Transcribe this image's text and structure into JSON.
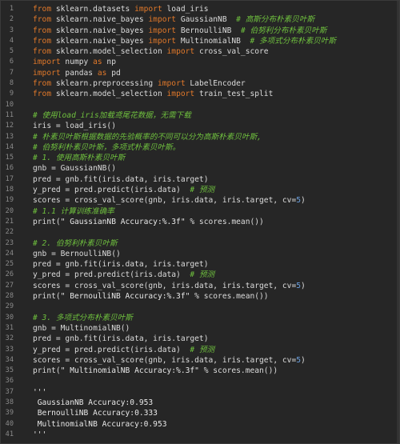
{
  "lines": [
    {
      "n": "1",
      "segs": [
        [
          "kw",
          "from"
        ],
        [
          "txt",
          " sklearn.datasets "
        ],
        [
          "kw",
          "import"
        ],
        [
          "txt",
          " load_iris"
        ]
      ]
    },
    {
      "n": "2",
      "segs": [
        [
          "kw",
          "from"
        ],
        [
          "txt",
          " sklearn.naive_bayes "
        ],
        [
          "kw",
          "import"
        ],
        [
          "txt",
          " GaussianNB  "
        ],
        [
          "cm",
          "# 高斯分布朴素贝叶斯"
        ]
      ]
    },
    {
      "n": "3",
      "segs": [
        [
          "kw",
          "from"
        ],
        [
          "txt",
          " sklearn.naive_bayes "
        ],
        [
          "kw",
          "import"
        ],
        [
          "txt",
          " BernoulliNB  "
        ],
        [
          "cm",
          "# 伯努利分布朴素贝叶斯"
        ]
      ]
    },
    {
      "n": "4",
      "segs": [
        [
          "kw",
          "from"
        ],
        [
          "txt",
          " sklearn.naive_bayes "
        ],
        [
          "kw",
          "import"
        ],
        [
          "txt",
          " MultinomialNB  "
        ],
        [
          "cm",
          "# 多项式分布朴素贝叶斯"
        ]
      ]
    },
    {
      "n": "5",
      "segs": [
        [
          "kw",
          "from"
        ],
        [
          "txt",
          " sklearn.model_selection "
        ],
        [
          "kw",
          "import"
        ],
        [
          "txt",
          " cross_val_score"
        ]
      ]
    },
    {
      "n": "6",
      "segs": [
        [
          "kw",
          "import"
        ],
        [
          "txt",
          " numpy "
        ],
        [
          "kw",
          "as"
        ],
        [
          "txt",
          " np"
        ]
      ]
    },
    {
      "n": "7",
      "segs": [
        [
          "kw",
          "import"
        ],
        [
          "txt",
          " pandas "
        ],
        [
          "kw",
          "as"
        ],
        [
          "txt",
          " pd"
        ]
      ]
    },
    {
      "n": "8",
      "segs": [
        [
          "kw",
          "from"
        ],
        [
          "txt",
          " sklearn.preprocessing "
        ],
        [
          "kw",
          "import"
        ],
        [
          "txt",
          " LabelEncoder"
        ]
      ]
    },
    {
      "n": "9",
      "segs": [
        [
          "kw",
          "from"
        ],
        [
          "txt",
          " sklearn.model_selection "
        ],
        [
          "kw",
          "import"
        ],
        [
          "txt",
          " train_test_split"
        ]
      ]
    },
    {
      "n": "10",
      "segs": []
    },
    {
      "n": "11",
      "segs": [
        [
          "cm",
          "# 使用load_iris加载鸢尾花数据，无需下载"
        ]
      ]
    },
    {
      "n": "12",
      "segs": [
        [
          "txt",
          "iris = load_iris()"
        ]
      ]
    },
    {
      "n": "13",
      "segs": [
        [
          "cm",
          "# 朴素贝叶斯根据数据的先验概率的不同可以分为高斯朴素贝叶斯,"
        ]
      ]
    },
    {
      "n": "14",
      "segs": [
        [
          "cm",
          "# 伯努利朴素贝叶斯，多项式朴素贝叶斯。"
        ]
      ]
    },
    {
      "n": "15",
      "segs": [
        [
          "cm",
          "# 1. 使用高斯朴素贝叶斯"
        ]
      ]
    },
    {
      "n": "16",
      "segs": [
        [
          "txt",
          "gnb = GaussianNB()"
        ]
      ]
    },
    {
      "n": "17",
      "segs": [
        [
          "txt",
          "pred = gnb.fit(iris.data, iris.target)"
        ]
      ]
    },
    {
      "n": "18",
      "segs": [
        [
          "txt",
          "y_pred = pred.predict(iris.data)  "
        ],
        [
          "cm",
          "# 预测"
        ]
      ]
    },
    {
      "n": "19",
      "segs": [
        [
          "txt",
          "scores = cross_val_score(gnb, iris.data, iris.target, cv="
        ],
        [
          "num",
          "5"
        ],
        [
          "txt",
          ")"
        ]
      ]
    },
    {
      "n": "20",
      "segs": [
        [
          "cm",
          "# 1.1 计算训练准确率"
        ]
      ]
    },
    {
      "n": "21",
      "segs": [
        [
          "txt",
          "print("
        ],
        [
          "str",
          "\" GaussianNB Accuracy:%.3f\""
        ],
        [
          "txt",
          " % scores.mean())"
        ]
      ]
    },
    {
      "n": "22",
      "segs": []
    },
    {
      "n": "23",
      "segs": [
        [
          "cm",
          "# 2. 伯努利朴素贝叶斯"
        ]
      ]
    },
    {
      "n": "24",
      "segs": [
        [
          "txt",
          "gnb = BernoulliNB()"
        ]
      ]
    },
    {
      "n": "25",
      "segs": [
        [
          "txt",
          "pred = gnb.fit(iris.data, iris.target)"
        ]
      ]
    },
    {
      "n": "26",
      "segs": [
        [
          "txt",
          "y_pred = pred.predict(iris.data)  "
        ],
        [
          "cm",
          "# 预测"
        ]
      ]
    },
    {
      "n": "27",
      "segs": [
        [
          "txt",
          "scores = cross_val_score(gnb, iris.data, iris.target, cv="
        ],
        [
          "num",
          "5"
        ],
        [
          "txt",
          ")"
        ]
      ]
    },
    {
      "n": "28",
      "segs": [
        [
          "txt",
          "print("
        ],
        [
          "str",
          "\" BernoulliNB Accuracy:%.3f\""
        ],
        [
          "txt",
          " % scores.mean())"
        ]
      ]
    },
    {
      "n": "29",
      "segs": []
    },
    {
      "n": "30",
      "segs": [
        [
          "cm",
          "# 3. 多项式分布朴素贝叶斯"
        ]
      ]
    },
    {
      "n": "31",
      "segs": [
        [
          "txt",
          "gnb = MultinomialNB()"
        ]
      ]
    },
    {
      "n": "32",
      "segs": [
        [
          "txt",
          "pred = gnb.fit(iris.data, iris.target)"
        ]
      ]
    },
    {
      "n": "33",
      "segs": [
        [
          "txt",
          "y_pred = pred.predict(iris.data)  "
        ],
        [
          "cm",
          "# 预测"
        ]
      ]
    },
    {
      "n": "34",
      "segs": [
        [
          "txt",
          "scores = cross_val_score(gnb, iris.data, iris.target, cv="
        ],
        [
          "num",
          "5"
        ],
        [
          "txt",
          ")"
        ]
      ]
    },
    {
      "n": "35",
      "segs": [
        [
          "txt",
          "print("
        ],
        [
          "str",
          "\" MultinomialNB Accuracy:%.3f\""
        ],
        [
          "txt",
          " % scores.mean())"
        ]
      ]
    },
    {
      "n": "36",
      "segs": []
    },
    {
      "n": "37",
      "segs": [
        [
          "str",
          "'''"
        ]
      ]
    },
    {
      "n": "38",
      "segs": [
        [
          "str",
          " GaussianNB Accuracy:0.953"
        ]
      ]
    },
    {
      "n": "39",
      "segs": [
        [
          "str",
          " BernoulliNB Accuracy:0.333"
        ]
      ]
    },
    {
      "n": "40",
      "segs": [
        [
          "str",
          " MultinomialNB Accuracy:0.953"
        ]
      ]
    },
    {
      "n": "41",
      "segs": [
        [
          "str",
          "'''"
        ]
      ]
    }
  ]
}
